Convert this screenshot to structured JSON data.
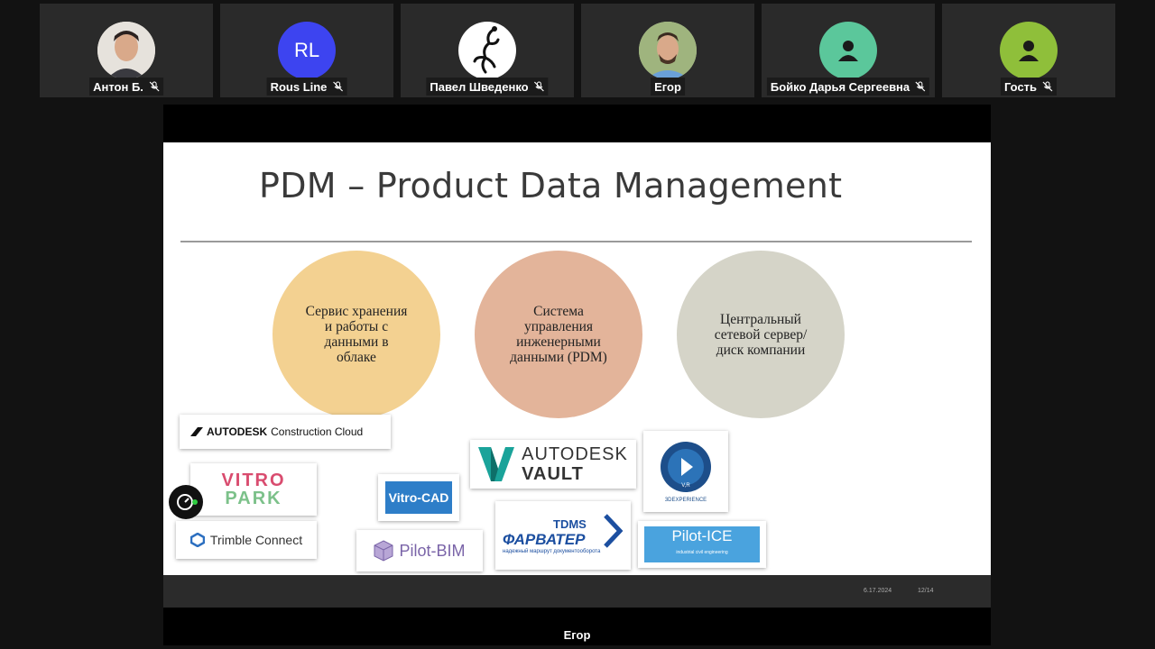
{
  "participants": [
    {
      "name": "Антон Б.",
      "initials": "",
      "avatar_type": "photo",
      "muted": true
    },
    {
      "name": "Rous Line",
      "initials": "RL",
      "avatar_color": "#3d44f0",
      "muted": true
    },
    {
      "name": "Павел Шведенко",
      "initials": "",
      "avatar_type": "lizard-image",
      "muted": true
    },
    {
      "name": "Егор",
      "initials": "",
      "avatar_type": "photo",
      "muted": false
    },
    {
      "name": "Бойко Дарья Сергеевна",
      "initials": "",
      "avatar_color": "#5bc79b",
      "avatar_type": "person-icon",
      "muted": true
    },
    {
      "name": "Гость",
      "initials": "",
      "avatar_color": "#8fbf3a",
      "avatar_type": "person-icon",
      "muted": true
    }
  ],
  "slide": {
    "title": "PDM – Product Data Management",
    "circles": [
      {
        "text": "Сервис хранения и работы с данными в облаке",
        "color": "#f3d191"
      },
      {
        "text": "Система управления инженерными данными (PDM)",
        "color": "#e3b49a"
      },
      {
        "text": "Центральный сетевой сервер/диск компании",
        "color": "#d5d4c8"
      }
    ],
    "logos": {
      "acc": {
        "brand": "AUTODESK",
        "product": "Construction Cloud"
      },
      "vitro_park": {
        "line1": "VITRO",
        "line2": "PARK"
      },
      "trimble": {
        "text": "Trimble Connect"
      },
      "vitro_cad": {
        "text": "Vitro-CAD"
      },
      "pilot_bim": {
        "text": "Pilot-BIM"
      },
      "vault": {
        "line1": "AUTODESK",
        "line2": "VAULT"
      },
      "tdms": {
        "line1": "TDMS",
        "line2": "ФАРВАТЕР",
        "line3": "надежный маршрут документооборота"
      },
      "three_d": {
        "text": "3DEXPERIENCE",
        "mark": "V,R"
      },
      "pilot_ice": {
        "text": "Pilot-ICE",
        "sub": "industrial civil engineering"
      }
    },
    "footer": {
      "date": "6.17.2024",
      "page": "12/14"
    }
  },
  "share_name": "Егор",
  "colors": {
    "background": "#121212",
    "tile": "#2a2a2a",
    "slide_bg": "#ffffff"
  }
}
